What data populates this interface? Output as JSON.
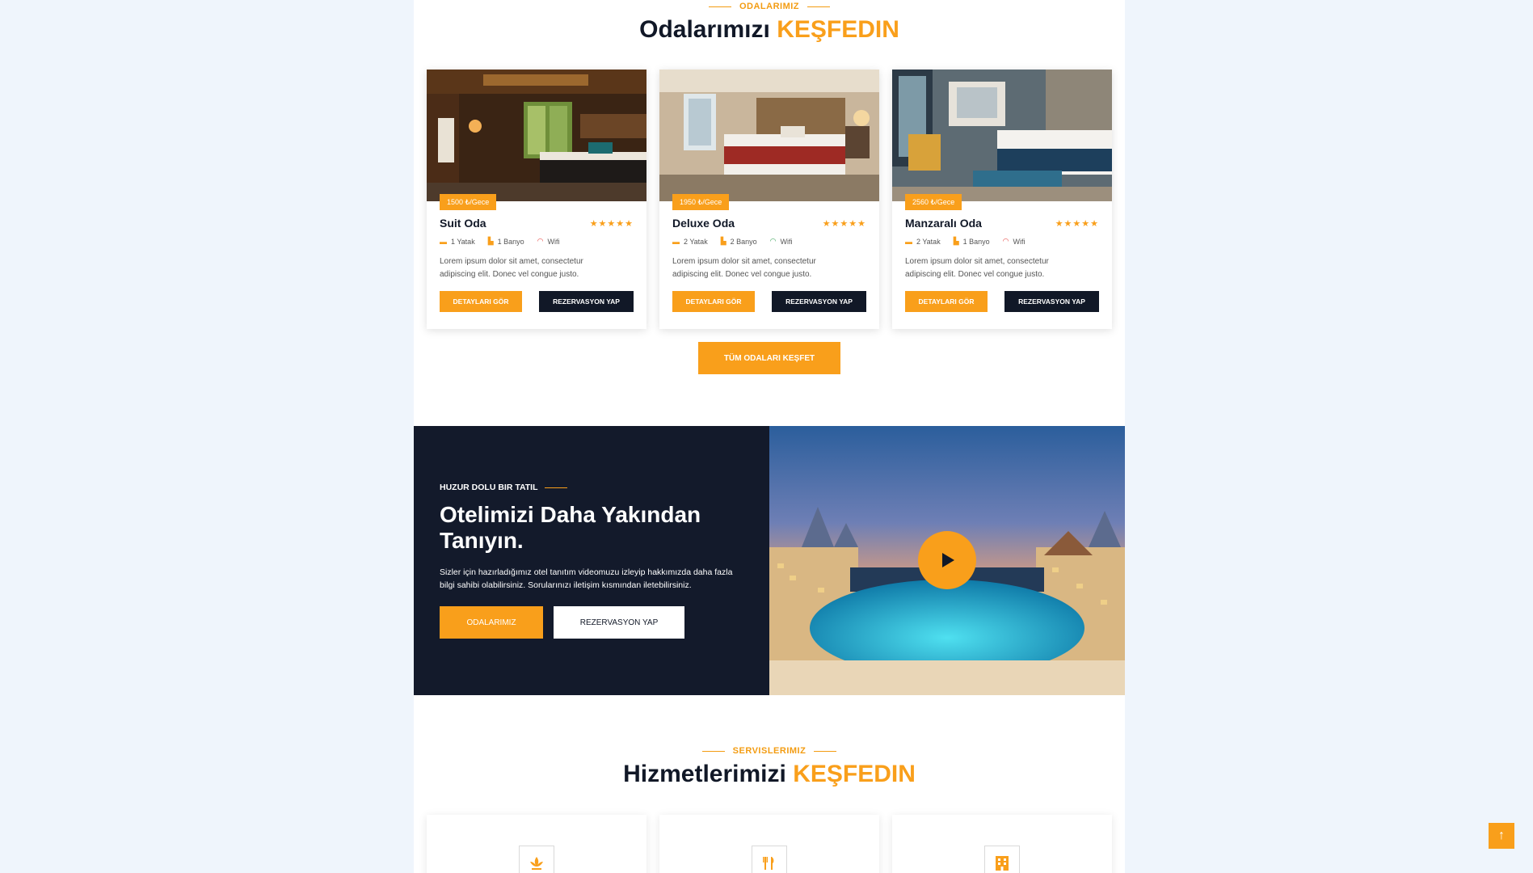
{
  "rooms_section": {
    "eyebrow": "ODALARIMIZ",
    "title_main": "Odalarımızı",
    "title_accent": "KEŞFEDIN",
    "rooms": [
      {
        "price": "1500 ₺/Gece",
        "name": "Suit Oda",
        "rating": "★★★★★",
        "beds": "1 Yatak",
        "baths": "1 Banyo",
        "wifi": "Wifi",
        "desc": "Lorem ipsum dolor sit amet, consectetur adipiscing elit. Donec vel congue justo.",
        "details": "DETAYLARI GÖR",
        "reserve": "REZERVASYON YAP"
      },
      {
        "price": "1950 ₺/Gece",
        "name": "Deluxe Oda",
        "rating": "★★★★★",
        "beds": "2 Yatak",
        "baths": "2 Banyo",
        "wifi": "Wifi",
        "desc": "Lorem ipsum dolor sit amet, consectetur adipiscing elit. Donec vel congue justo.",
        "details": "DETAYLARI GÖR",
        "reserve": "REZERVASYON YAP"
      },
      {
        "price": "2560 ₺/Gece",
        "name": "Manzaralı Oda",
        "rating": "★★★★★",
        "beds": "2 Yatak",
        "baths": "1 Banyo",
        "wifi": "Wifi",
        "desc": "Lorem ipsum dolor sit amet, consectetur adipiscing elit. Donec vel congue justo.",
        "details": "DETAYLARI GÖR",
        "reserve": "REZERVASYON YAP"
      }
    ],
    "all_rooms_button": "TÜM ODALARI KEŞFET"
  },
  "promo": {
    "eyebrow": "HUZUR DOLU BIR TATIL",
    "title": "Otelimizi Daha Yakından Tanıyın.",
    "text": "Sizler için hazırladığımız otel tanıtım videomuzu izleyip hakkımızda daha fazla bilgi sahibi olabilirsiniz. Sorularınızı iletişim kısmından iletebilirsiniz.",
    "btn_rooms": "ODALARIMIZ",
    "btn_reserve": "REZERVASYON YAP"
  },
  "services_section": {
    "eyebrow": "SERVISLERIMIZ",
    "title_main": "Hizmetlerimizi",
    "title_accent": "KEŞFEDIN",
    "icons": [
      "spa-icon",
      "restaurant-icon",
      "hotel-icon"
    ]
  },
  "scroll_top": "↑",
  "colors": {
    "accent": "#f99f1b",
    "dark": "#131a2b",
    "page_bg": "#eff5fc"
  }
}
